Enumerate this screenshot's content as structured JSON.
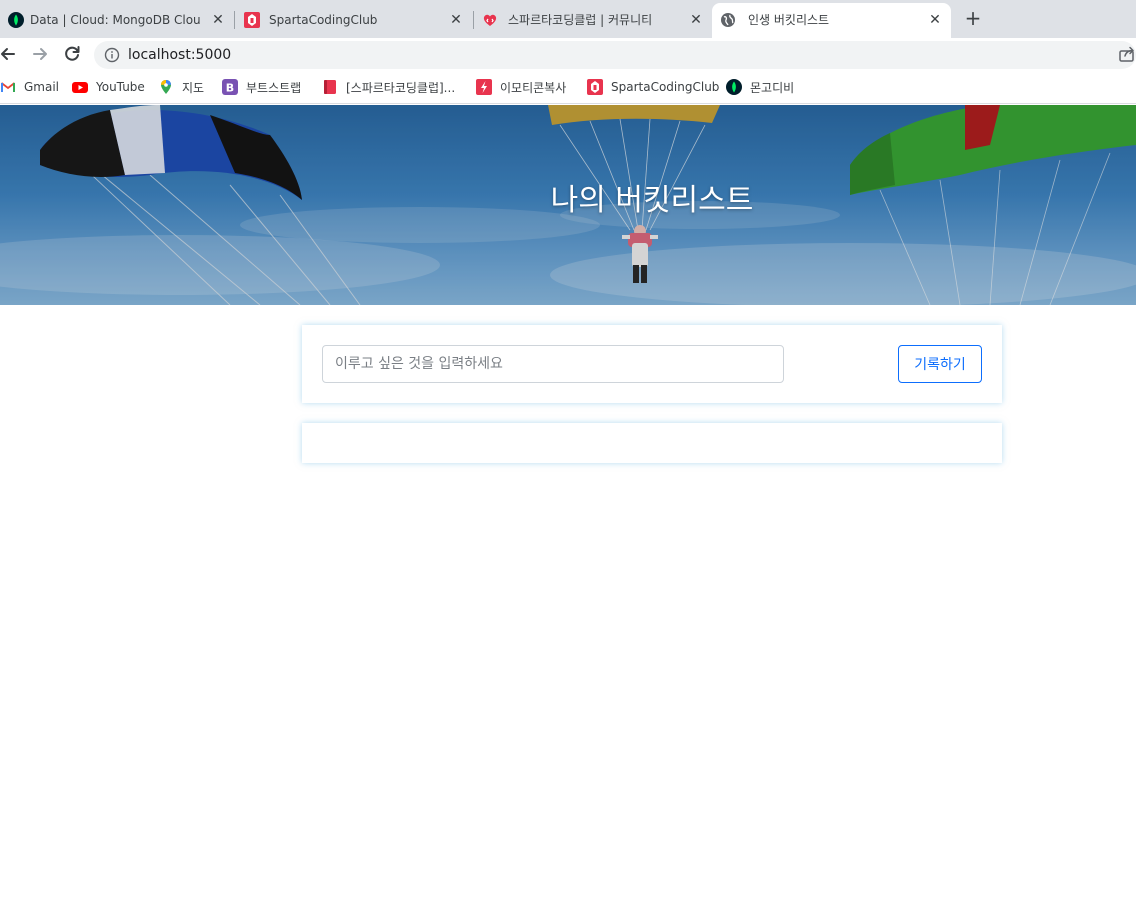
{
  "browser": {
    "tabs": [
      {
        "title": "Data | Cloud: MongoDB Cloud",
        "icon": "mongodb-leaf-icon",
        "active": false
      },
      {
        "title": "SpartaCodingClub",
        "icon": "spartacodingclub-icon",
        "active": false
      },
      {
        "title": "스파르타코딩클럽 | 커뮤니티",
        "icon": "community-heart-icon",
        "active": false
      },
      {
        "title": "인생 버킷리스트",
        "icon": "globe-icon",
        "active": true
      }
    ],
    "address": "localhost:5000",
    "bookmarks": [
      {
        "label": "Gmail",
        "icon": "gmail-icon"
      },
      {
        "label": "YouTube",
        "icon": "youtube-icon"
      },
      {
        "label": "지도",
        "icon": "maps-pin-icon"
      },
      {
        "label": "부트스트랩",
        "icon": "bootstrap-icon"
      },
      {
        "label": "[스파르타코딩클럽]...",
        "icon": "book-icon"
      },
      {
        "label": "이모티콘복사",
        "icon": "emoticon-bolt-icon"
      },
      {
        "label": "SpartaCodingClub",
        "icon": "spartacodingclub-icon"
      },
      {
        "label": "몬고디비",
        "icon": "mongodb-leaf-icon"
      }
    ]
  },
  "page": {
    "title": "나의 버킷리스트",
    "input_placeholder": "이루고 싶은 것을 입력하세요",
    "input_value": "",
    "save_label": "기록하기",
    "bucket_items": []
  },
  "colors": {
    "accent": "#0d6efd",
    "tabstrip": "#dee1e6",
    "omnibox": "#f1f3f4"
  }
}
